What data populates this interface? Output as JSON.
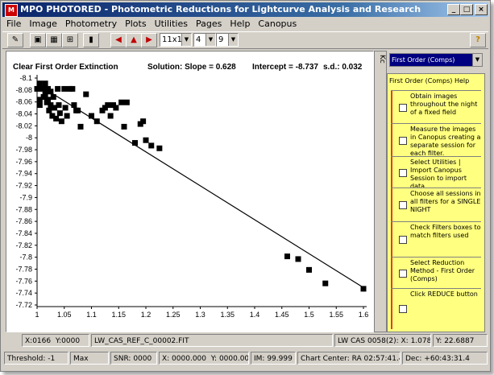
{
  "window": {
    "title": "MPO PHOTORED - Photometric Reductions for Lightcurve Analysis and Research",
    "app_icon": "mpo-icon"
  },
  "menu": [
    "File",
    "Image",
    "Photometry",
    "Plots",
    "Utilities",
    "Pages",
    "Help",
    "Canopus"
  ],
  "toolbar": {
    "icons": [
      "wrench-icon",
      "image-icon",
      "grid-icon",
      "chart-icon",
      "book-icon",
      "arrow-left-icon",
      "arrow-up-icon",
      "arrow-right-icon"
    ],
    "box_size": "11x11",
    "value2": "4",
    "value3": "9",
    "help_icon": "?"
  },
  "chart": {
    "heading": "Clear First Order Extinction",
    "solution": "Solution:  Slope = 0.628",
    "intercept": "Intercept = -8.737",
    "sd": "s.d.: 0.032"
  },
  "chart_data": {
    "type": "scatter",
    "title": "Clear First Order Extinction",
    "xlim": [
      1.0,
      1.6
    ],
    "ylim": [
      -8.12,
      -7.7
    ],
    "y_reversed": true,
    "x_ticks": [
      "1",
      "1.05",
      "1.1",
      "1.15",
      "1.2",
      "1.25",
      "1.3",
      "1.35",
      "1.4",
      "1.45",
      "1.5",
      "1.55",
      "1.6"
    ],
    "y_ticks": [
      "-8.1",
      "-8.08",
      "-8.06",
      "-8.04",
      "-8.02",
      "-8",
      "-7.98",
      "-7.96",
      "-7.94",
      "-7.92",
      "-7.9",
      "-7.88",
      "-7.86",
      "-7.84",
      "-7.82",
      "-7.8",
      "-7.78",
      "-7.76",
      "-7.74",
      "-7.72"
    ],
    "fit_line": {
      "slope": 0.628,
      "intercept": -8.737
    },
    "points": [
      [
        1.0,
        -8.1
      ],
      [
        1.005,
        -8.11
      ],
      [
        1.005,
        -8.08
      ],
      [
        1.005,
        -8.07
      ],
      [
        1.01,
        -8.1
      ],
      [
        1.012,
        -8.085
      ],
      [
        1.015,
        -8.11
      ],
      [
        1.015,
        -8.09
      ],
      [
        1.018,
        -8.075
      ],
      [
        1.02,
        -8.1
      ],
      [
        1.02,
        -8.08
      ],
      [
        1.022,
        -8.06
      ],
      [
        1.025,
        -8.095
      ],
      [
        1.025,
        -8.07
      ],
      [
        1.028,
        -8.05
      ],
      [
        1.03,
        -8.085
      ],
      [
        1.032,
        -8.065
      ],
      [
        1.035,
        -8.045
      ],
      [
        1.038,
        -8.1
      ],
      [
        1.04,
        -8.07
      ],
      [
        1.042,
        -8.055
      ],
      [
        1.045,
        -8.04
      ],
      [
        1.05,
        -8.1
      ],
      [
        1.052,
        -8.065
      ],
      [
        1.055,
        -8.05
      ],
      [
        1.06,
        -8.1
      ],
      [
        1.065,
        -8.1
      ],
      [
        1.068,
        -8.07
      ],
      [
        1.072,
        -8.06
      ],
      [
        1.075,
        -8.06
      ],
      [
        1.08,
        -8.03
      ],
      [
        1.09,
        -8.09
      ],
      [
        1.1,
        -8.05
      ],
      [
        1.11,
        -8.04
      ],
      [
        1.12,
        -8.06
      ],
      [
        1.125,
        -8.065
      ],
      [
        1.13,
        -8.07
      ],
      [
        1.135,
        -8.05
      ],
      [
        1.14,
        -8.07
      ],
      [
        1.145,
        -8.065
      ],
      [
        1.155,
        -8.075
      ],
      [
        1.16,
        -8.03
      ],
      [
        1.165,
        -8.075
      ],
      [
        1.18,
        -8.0
      ],
      [
        1.19,
        -8.035
      ],
      [
        1.195,
        -8.04
      ],
      [
        1.2,
        -8.005
      ],
      [
        1.21,
        -7.995
      ],
      [
        1.225,
        -7.99
      ],
      [
        1.46,
        -7.79
      ],
      [
        1.48,
        -7.785
      ],
      [
        1.5,
        -7.765
      ],
      [
        1.53,
        -7.74
      ],
      [
        1.6,
        -7.73
      ]
    ]
  },
  "side_tab_label": "Kc",
  "right_panel": {
    "method": "First Order (Comps)",
    "help_title": "First Order (Comps) Help",
    "steps": [
      "Obtain images throughout the night of a fixed field",
      "Measure the images in Canopus creating a separate session for each filter.",
      "Select Utilities | Import Canopus Session to import data",
      "Choose all sessions in all filters for a SINGLE NIGHT",
      "Check Filters boxes to match filters used",
      "Select Reduction Method - First Order (Comps)",
      "Click REDUCE button"
    ]
  },
  "status": {
    "xpos": "X:0166",
    "ypos": "Y:0000",
    "filename": "LW_CAS_REF_C_00002.FIT",
    "target": "LW CAS 0058(2): X: 1.0786",
    "target_y": "Y: 22.6887",
    "threshold": "Threshold:  -1",
    "max": "Max",
    "snr": "SNR: 0000",
    "x2": "X: 0000.000",
    "y2": "Y: 0000.000",
    "im": "IM: 99.999",
    "center": "Chart Center: RA 02:57:41.43",
    "dec": "Dec: +60:43:31.4"
  }
}
